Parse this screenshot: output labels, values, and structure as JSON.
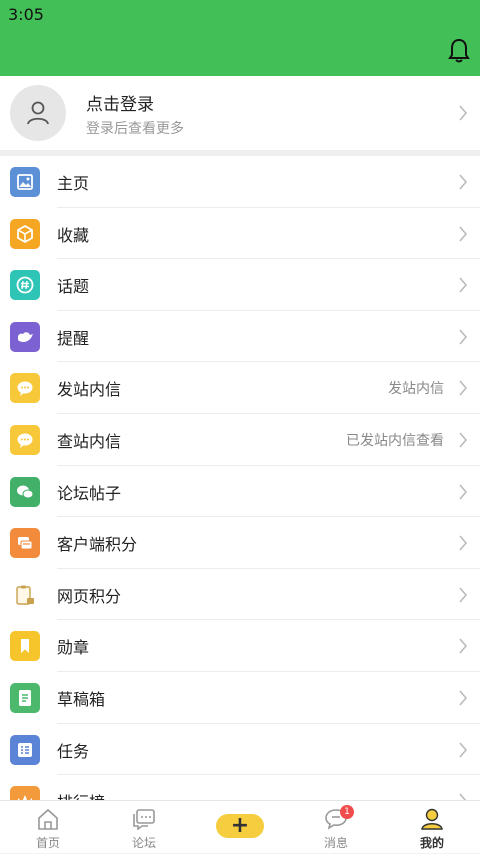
{
  "status_bar": {
    "time": "3:05"
  },
  "login": {
    "title": "点击登录",
    "subtitle": "登录后查看更多"
  },
  "menu": [
    {
      "label": "主页",
      "right": "",
      "color": "#5b8fd6",
      "icon": "image-icon"
    },
    {
      "label": "收藏",
      "right": "",
      "color": "#f5a623",
      "icon": "box-icon"
    },
    {
      "label": "话题",
      "right": "",
      "color": "#2ec4b6",
      "icon": "hash-icon"
    },
    {
      "label": "提醒",
      "right": "",
      "color": "#7b61d1",
      "icon": "bird-icon"
    },
    {
      "label": "发站内信",
      "right": "发站内信",
      "color": "#f7c83a",
      "icon": "chat-bubble-icon"
    },
    {
      "label": "查站内信",
      "right": "已发站内信查看",
      "color": "#f7c83a",
      "icon": "chat-bubble-icon"
    },
    {
      "label": "论坛帖子",
      "right": "",
      "color": "#43b06a",
      "icon": "chat-icon"
    },
    {
      "label": "客户端积分",
      "right": "",
      "color": "#f38b3c",
      "icon": "coins-icon"
    },
    {
      "label": "网页积分",
      "right": "",
      "color": "#d4b26a",
      "icon": "clipboard-icon"
    },
    {
      "label": "勋章",
      "right": "",
      "color": "#f6c52c",
      "icon": "bookmark-icon"
    },
    {
      "label": "草稿箱",
      "right": "",
      "color": "#4bb86c",
      "icon": "draft-icon"
    },
    {
      "label": "任务",
      "right": "",
      "color": "#5b84d6",
      "icon": "task-list-icon"
    },
    {
      "label": "排行榜",
      "right": "",
      "color": "#f39a3c",
      "icon": "ranking-icon"
    }
  ],
  "tabbar": {
    "home": "首页",
    "forum": "论坛",
    "messages": "消息",
    "messages_badge": "1",
    "mine": "我的"
  }
}
